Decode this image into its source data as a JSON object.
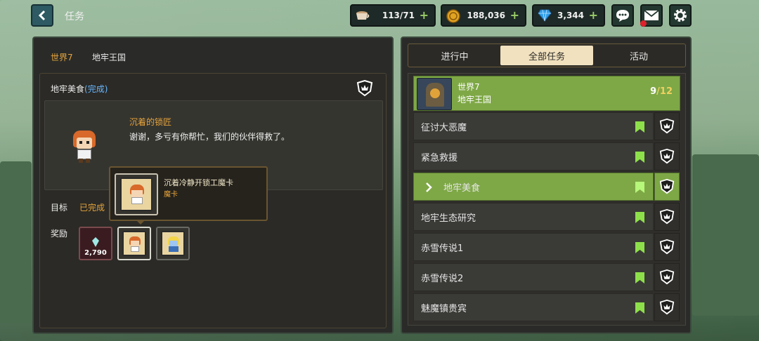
{
  "header": {
    "back_icon": "chevron-left-icon",
    "title": "任务",
    "resources": [
      {
        "name": "coffee",
        "icon": "coffee-cup-icon",
        "value": "113/71"
      },
      {
        "name": "gold",
        "icon": "gold-coin-icon",
        "value": "188,036"
      },
      {
        "name": "gem",
        "icon": "blue-gem-icon",
        "value": "3,344"
      }
    ],
    "buttons": [
      "chat-icon",
      "mail-icon",
      "gear-icon"
    ]
  },
  "left_panel": {
    "breadcrumb_world": "世界7",
    "breadcrumb_region": "地牢王国",
    "quest_title": "地牢美食",
    "quest_status": "(完成)",
    "npc_name": "沉着的锁匠",
    "npc_dialog": "谢谢，多亏有你帮忙，我们的伙伴得救了。",
    "goal_label": "目标",
    "goal_value": "已完成",
    "reward_label": "奖励",
    "reward_gem_count": "2,790",
    "tooltip_title": "沉着冷静开锁工魔卡",
    "tooltip_sub": "魔卡"
  },
  "right_panel": {
    "tabs": [
      "进行中",
      "全部任务",
      "活动"
    ],
    "active_tab": "全部任务",
    "group_world": "世界7",
    "group_region": "地牢王国",
    "group_progress_done": "9",
    "group_progress_sep": "/",
    "group_progress_total": "12",
    "quests": [
      "征讨大恶魔",
      "紧急救援",
      "地牢美食",
      "地牢生态研究",
      "赤雪传说1",
      "赤雪传说2",
      "魅魔镇贵宾"
    ],
    "selected_quest": "地牢美食"
  },
  "colors": {
    "accent_green": "#7ea846",
    "bookmark_green": "#8ee04a",
    "highlight_orange": "#e6a43c",
    "tab_active": "#f1e1bf"
  }
}
